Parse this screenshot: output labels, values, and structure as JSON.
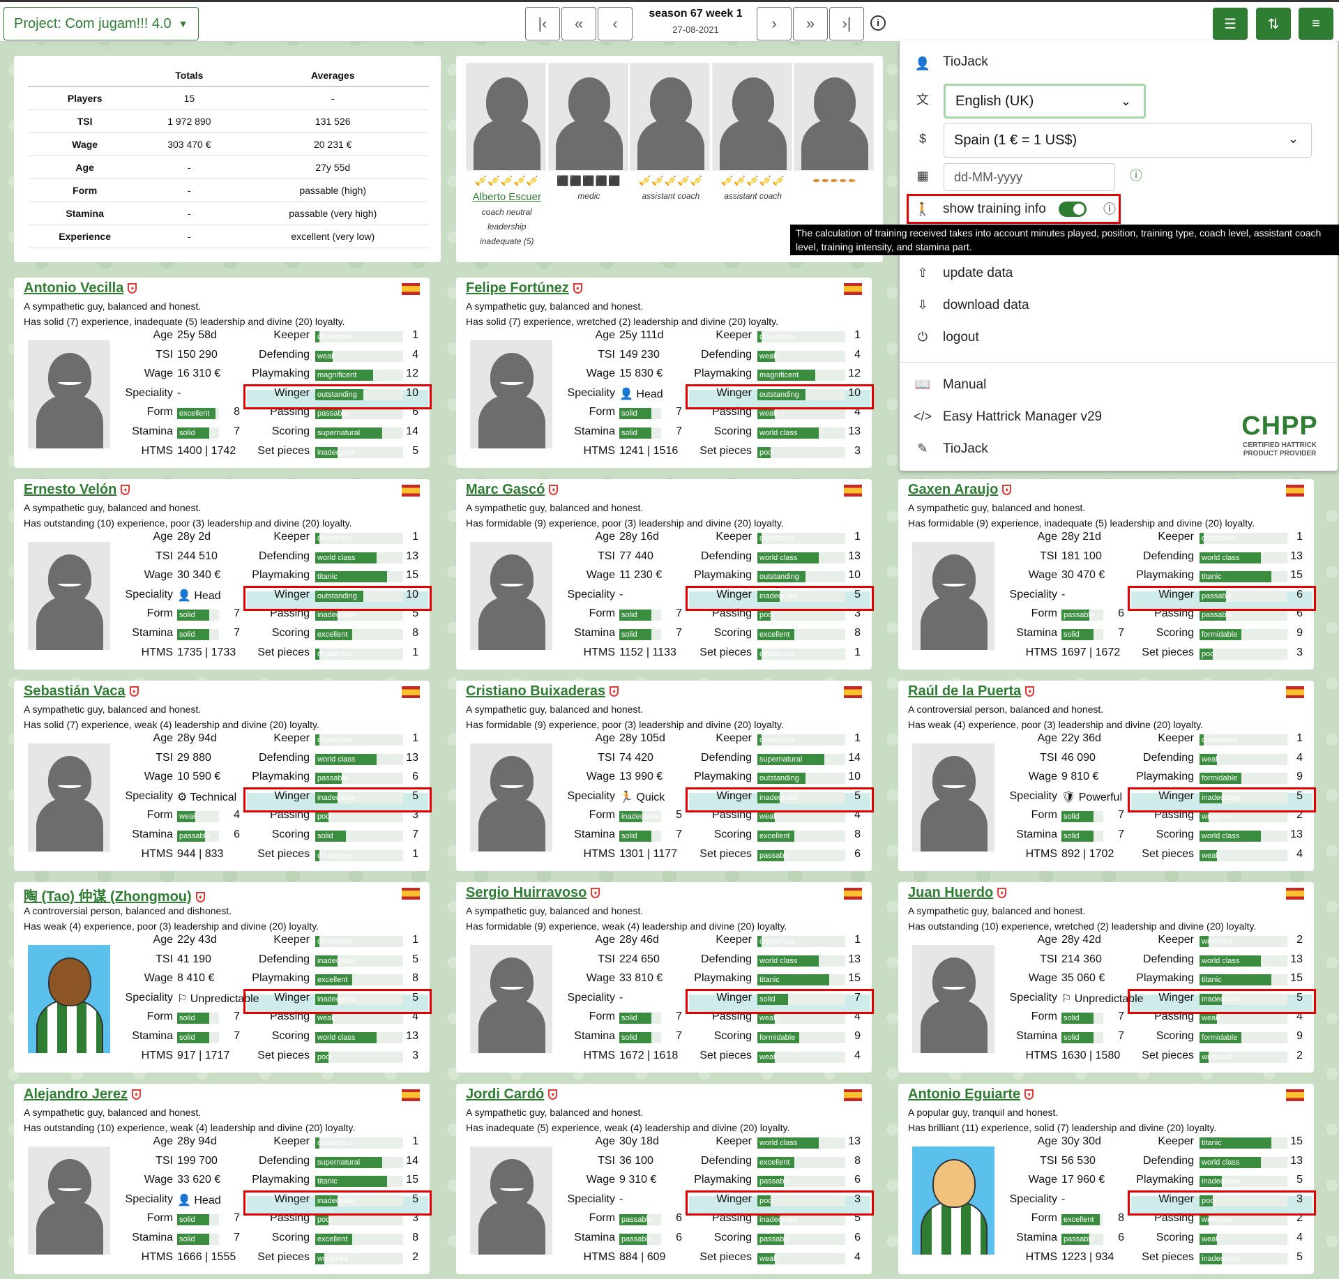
{
  "topbar": {
    "project": "Project: Com jugam!!! 4.0",
    "season": "season 67 week 1",
    "date": "27-08-2021",
    "nav": [
      "|‹",
      "«",
      "‹",
      "›",
      "»",
      "›|"
    ]
  },
  "totals": {
    "headers": [
      "",
      "Totals",
      "Averages"
    ],
    "rows": [
      [
        "Players",
        "15",
        "-"
      ],
      [
        "TSI",
        "1 972 890",
        "131 526"
      ],
      [
        "Wage",
        "303 470 €",
        "20 231 €"
      ],
      [
        "Age",
        "-",
        "27y 55d"
      ],
      [
        "Form",
        "-",
        "passable (high)"
      ],
      [
        "Stamina",
        "-",
        "passable (very high)"
      ],
      [
        "Experience",
        "-",
        "excellent (very low)"
      ]
    ]
  },
  "staff": [
    {
      "name": "Alberto Escuer",
      "lines": [
        "coach neutral",
        "leadership",
        "inadequate (5)"
      ],
      "level": "🎺🎺🎺🎺🎺"
    },
    {
      "lines": [
        "medic"
      ],
      "level": "⬛⬛⬛⬛⬛"
    },
    {
      "lines": [
        "assistant coach"
      ],
      "level": "🎺🎺🎺🎺🎺"
    },
    {
      "lines": [
        "assistant coach"
      ],
      "level": "🎺🎺🎺🎺🎺"
    },
    {
      "lines": [
        ""
      ],
      "level": "✒✒✒✒✒"
    }
  ],
  "menu": {
    "user": "TioJack",
    "language": "English (UK)",
    "currency": "Spain (1 € = 1 US$)",
    "date_format": "dd-MM-yyyy",
    "training_label": "show training info",
    "tooltip": "The calculation of training received takes into account minutes played, position, training type, coach level, assistant coach level, training intensity, and stamina part.",
    "update": "update data",
    "download": "download data",
    "logout": "logout",
    "manual": "Manual",
    "app": "Easy Hattrick Manager v29",
    "author": "TioJack",
    "chpp": "CHPP",
    "chpp_sub1": "CERTIFIED HATTRICK",
    "chpp_sub2": "PRODUCT PROVIDER"
  },
  "labels": {
    "age": "Age",
    "tsi": "TSI",
    "wage": "Wage",
    "speciality": "Speciality",
    "form": "Form",
    "stamina": "Stamina",
    "htms": "HTMS",
    "keeper": "Keeper",
    "defending": "Defending",
    "playmaking": "Playmaking",
    "winger": "Winger",
    "passing": "Passing",
    "scoring": "Scoring",
    "setpieces": "Set pieces"
  },
  "players": [
    {
      "name": "Antonio Vecilla",
      "d1": "A sympathetic guy, balanced and honest.",
      "d2": "Has solid (7) experience, inadequate (5) leadership and divine (20) loyalty.",
      "age": "25y 58d",
      "tsi": "150 290",
      "wage": "16 310 €",
      "spec": "-",
      "form": [
        "excellent",
        8
      ],
      "stamina": [
        "solid",
        7
      ],
      "htms": "1400 | 1742",
      "skills": [
        [
          "disastrous",
          1
        ],
        [
          "weak",
          4
        ],
        [
          "magnificent",
          12
        ],
        [
          "outstanding",
          10
        ],
        [
          "passable",
          6
        ],
        [
          "supernatural",
          14
        ],
        [
          "inadequate",
          5
        ]
      ],
      "face": ""
    },
    {
      "name": "Felipe Fortúnez",
      "d1": "A sympathetic guy, balanced and honest.",
      "d2": "Has solid (7) experience, wretched (2) leadership and divine (20) loyalty.",
      "age": "25y 111d",
      "tsi": "149 230",
      "wage": "15 830 €",
      "spec": "👤 Head",
      "form": [
        "solid",
        7
      ],
      "stamina": [
        "solid",
        7
      ],
      "htms": "1241 | 1516",
      "skills": [
        [
          "disastrous",
          1
        ],
        [
          "weak",
          4
        ],
        [
          "magnificent",
          12
        ],
        [
          "outstanding",
          10
        ],
        [
          "weak",
          4
        ],
        [
          "world class",
          13
        ],
        [
          "poor",
          3
        ]
      ],
      "face": ""
    },
    {
      "name": "Ernesto Velón",
      "d1": "A sympathetic guy, balanced and honest.",
      "d2": "Has outstanding (10) experience, poor (3) leadership and divine (20) loyalty.",
      "age": "28y 2d",
      "tsi": "244 510",
      "wage": "30 340 €",
      "spec": "👤 Head",
      "form": [
        "solid",
        7
      ],
      "stamina": [
        "solid",
        7
      ],
      "htms": "1735 | 1733",
      "skills": [
        [
          "disastrous",
          1
        ],
        [
          "world class",
          13
        ],
        [
          "titanic",
          15
        ],
        [
          "outstanding",
          10
        ],
        [
          "inadequate",
          5
        ],
        [
          "excellent",
          8
        ],
        [
          "disastrous",
          1
        ]
      ],
      "face": ""
    },
    {
      "name": "Marc Gascó",
      "d1": "A sympathetic guy, balanced and honest.",
      "d2": "Has formidable (9) experience, poor (3) leadership and divine (20) loyalty.",
      "age": "28y 16d",
      "tsi": "77 440",
      "wage": "11 230 €",
      "spec": "-",
      "form": [
        "solid",
        7
      ],
      "stamina": [
        "solid",
        7
      ],
      "htms": "1152 | 1133",
      "skills": [
        [
          "disastrous",
          1
        ],
        [
          "world class",
          13
        ],
        [
          "outstanding",
          10
        ],
        [
          "inadequate",
          5
        ],
        [
          "poor",
          3
        ],
        [
          "excellent",
          8
        ],
        [
          "disastrous",
          1
        ]
      ],
      "face": ""
    },
    {
      "name": "Gaxen Araujo",
      "d1": "A sympathetic guy, balanced and honest.",
      "d2": "Has formidable (9) experience, inadequate (5) leadership and divine (20) loyalty.",
      "age": "28y 21d",
      "tsi": "181 100",
      "wage": "30 470 €",
      "spec": "-",
      "form": [
        "passable",
        6
      ],
      "stamina": [
        "solid",
        7
      ],
      "htms": "1697 | 1672",
      "skills": [
        [
          "disastrous",
          1
        ],
        [
          "world class",
          13
        ],
        [
          "titanic",
          15
        ],
        [
          "passable",
          6
        ],
        [
          "passable",
          6
        ],
        [
          "formidable",
          9
        ],
        [
          "poor",
          3
        ]
      ],
      "face": ""
    },
    {
      "name": "Sebastián Vaca",
      "d1": "A sympathetic guy, balanced and honest.",
      "d2": "Has solid (7) experience, weak (4) leadership and divine (20) loyalty.",
      "age": "28y 94d",
      "tsi": "29 880",
      "wage": "10 590 €",
      "spec": "⚙ Technical",
      "form": [
        "weak",
        4
      ],
      "stamina": [
        "passable",
        6
      ],
      "htms": "944 | 833",
      "skills": [
        [
          "disastrous",
          1
        ],
        [
          "world class",
          13
        ],
        [
          "passable",
          6
        ],
        [
          "inadequate",
          5
        ],
        [
          "poor",
          3
        ],
        [
          "solid",
          7
        ],
        [
          "disastrous",
          1
        ]
      ],
      "face": ""
    },
    {
      "name": "Cristiano Buixaderas",
      "d1": "A sympathetic guy, balanced and honest.",
      "d2": "Has formidable (9) experience, poor (3) leadership and divine (20) loyalty.",
      "age": "28y 105d",
      "tsi": "74 420",
      "wage": "13 990 €",
      "spec": "🏃 Quick",
      "form": [
        "inadequate",
        5
      ],
      "stamina": [
        "solid",
        7
      ],
      "htms": "1301 | 1177",
      "skills": [
        [
          "disastrous",
          1
        ],
        [
          "supernatural",
          14
        ],
        [
          "outstanding",
          10
        ],
        [
          "inadequate",
          5
        ],
        [
          "weak",
          4
        ],
        [
          "excellent",
          8
        ],
        [
          "passable",
          6
        ]
      ],
      "face": ""
    },
    {
      "name": "Raúl de la Puerta",
      "d1": "A controversial person, balanced and honest.",
      "d2": "Has weak (4) experience, poor (3) leadership and divine (20) loyalty.",
      "age": "22y 36d",
      "tsi": "46 090",
      "wage": "9 810 €",
      "spec": "🛡 Powerful",
      "form": [
        "solid",
        7
      ],
      "stamina": [
        "solid",
        7
      ],
      "htms": "892 | 1702",
      "skills": [
        [
          "disastrous",
          1
        ],
        [
          "weak",
          4
        ],
        [
          "formidable",
          9
        ],
        [
          "inadequate",
          5
        ],
        [
          "wretched",
          2
        ],
        [
          "world class",
          13
        ],
        [
          "weak",
          4
        ]
      ],
      "face": ""
    },
    {
      "name": "陶 (Tao) 仲谋 (Zhongmou)",
      "d1": "A controversial person, balanced and dishonest.",
      "d2": "Has weak (4) experience, poor (3) leadership and divine (20) loyalty.",
      "age": "22y 43d",
      "tsi": "41 190",
      "wage": "8 410 €",
      "spec": "⚐ Unpredictable",
      "form": [
        "solid",
        7
      ],
      "stamina": [
        "solid",
        7
      ],
      "htms": "917 | 1717",
      "skills": [
        [
          "disastrous",
          1
        ],
        [
          "inadequate",
          5
        ],
        [
          "excellent",
          8
        ],
        [
          "inadequate",
          5
        ],
        [
          "weak",
          4
        ],
        [
          "world class",
          13
        ],
        [
          "poor",
          3
        ]
      ],
      "face": "dark"
    },
    {
      "name": "Sergio Huirravoso",
      "d1": "A sympathetic guy, balanced and honest.",
      "d2": "Has formidable (9) experience, weak (4) leadership and divine (20) loyalty.",
      "age": "28y 46d",
      "tsi": "224 650",
      "wage": "33 810 €",
      "spec": "-",
      "form": [
        "solid",
        7
      ],
      "stamina": [
        "solid",
        7
      ],
      "htms": "1672 | 1618",
      "skills": [
        [
          "disastrous",
          1
        ],
        [
          "world class",
          13
        ],
        [
          "titanic",
          15
        ],
        [
          "solid",
          7
        ],
        [
          "weak",
          4
        ],
        [
          "formidable",
          9
        ],
        [
          "weak",
          4
        ]
      ],
      "face": ""
    },
    {
      "name": "Juan Huerdo",
      "d1": "A sympathetic guy, balanced and honest.",
      "d2": "Has outstanding (10) experience, wretched (2) leadership and divine (20) loyalty.",
      "age": "28y 42d",
      "tsi": "214 360",
      "wage": "35 060 €",
      "spec": "⚐ Unpredictable",
      "form": [
        "solid",
        7
      ],
      "stamina": [
        "solid",
        7
      ],
      "htms": "1630 | 1580",
      "skills": [
        [
          "wretched",
          2
        ],
        [
          "world class",
          13
        ],
        [
          "titanic",
          15
        ],
        [
          "inadequate",
          5
        ],
        [
          "weak",
          4
        ],
        [
          "formidable",
          9
        ],
        [
          "wretched",
          2
        ]
      ],
      "face": ""
    },
    {
      "name": "Alejandro Jerez",
      "d1": "A sympathetic guy, balanced and honest.",
      "d2": "Has outstanding (10) experience, weak (4) leadership and divine (20) loyalty.",
      "age": "28y 94d",
      "tsi": "199 700",
      "wage": "33 620 €",
      "spec": "👤 Head",
      "form": [
        "solid",
        7
      ],
      "stamina": [
        "solid",
        7
      ],
      "htms": "1666 | 1555",
      "skills": [
        [
          "disastrous",
          1
        ],
        [
          "supernatural",
          14
        ],
        [
          "titanic",
          15
        ],
        [
          "inadequate",
          5
        ],
        [
          "poor",
          3
        ],
        [
          "excellent",
          8
        ],
        [
          "wretched",
          2
        ]
      ],
      "face": ""
    },
    {
      "name": "Jordi Cardó",
      "d1": "A sympathetic guy, balanced and honest.",
      "d2": "Has inadequate (5) experience, weak (4) leadership and divine (20) loyalty.",
      "age": "30y 18d",
      "tsi": "36 100",
      "wage": "9 310 €",
      "spec": "-",
      "form": [
        "passable",
        6
      ],
      "stamina": [
        "passable",
        6
      ],
      "htms": "884 | 609",
      "skills": [
        [
          "world class",
          13
        ],
        [
          "excellent",
          8
        ],
        [
          "passable",
          6
        ],
        [
          "poor",
          3
        ],
        [
          "inadequate",
          5
        ],
        [
          "passable",
          6
        ],
        [
          "weak",
          4
        ]
      ],
      "face": ""
    },
    {
      "name": "Antonio Eguiarte",
      "d1": "A popular guy, tranquil and honest.",
      "d2": "Has brilliant (11) experience, solid (7) leadership and divine (20) loyalty.",
      "age": "30y 30d",
      "tsi": "56 530",
      "wage": "17 960 €",
      "spec": "-",
      "form": [
        "excellent",
        8
      ],
      "stamina": [
        "passable",
        6
      ],
      "htms": "1223 | 934",
      "skills": [
        [
          "titanic",
          15
        ],
        [
          "world class",
          13
        ],
        [
          "inadequate",
          5
        ],
        [
          "poor",
          3
        ],
        [
          "wretched",
          2
        ],
        [
          "weak",
          4
        ],
        [
          "inadequate",
          5
        ]
      ],
      "face": "light"
    }
  ]
}
